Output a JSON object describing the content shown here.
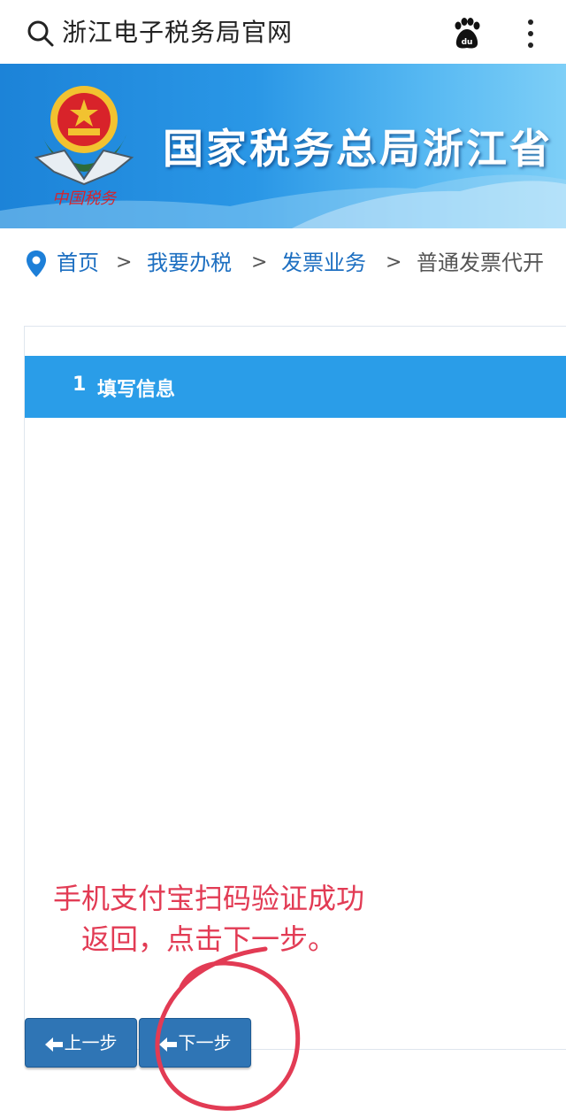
{
  "topbar": {
    "title": "浙江电子税务局官网",
    "icons": [
      "search-icon",
      "baidu-paw-icon",
      "more-vertical-icon"
    ]
  },
  "banner": {
    "title": "国家税务总局浙江省",
    "emblem_text": "中国税务"
  },
  "breadcrumb": {
    "items": [
      "首页",
      "我要办税",
      "发票业务"
    ],
    "separator": ">",
    "current": "普通发票代开"
  },
  "wizard": {
    "step_number": "1",
    "step_label": "填写信息"
  },
  "annotation": {
    "line1": "手机支付宝扫码验证成功",
    "line2": "返回，点击下一步。"
  },
  "buttons": {
    "prev_label": "上一步",
    "next_label": "下一步"
  },
  "colors": {
    "banner_blue": "#2a97e6",
    "step_header": "#2a9de8",
    "button": "#2f75b5",
    "link": "#1d6fc1",
    "annotation_red": "#e23b54"
  }
}
